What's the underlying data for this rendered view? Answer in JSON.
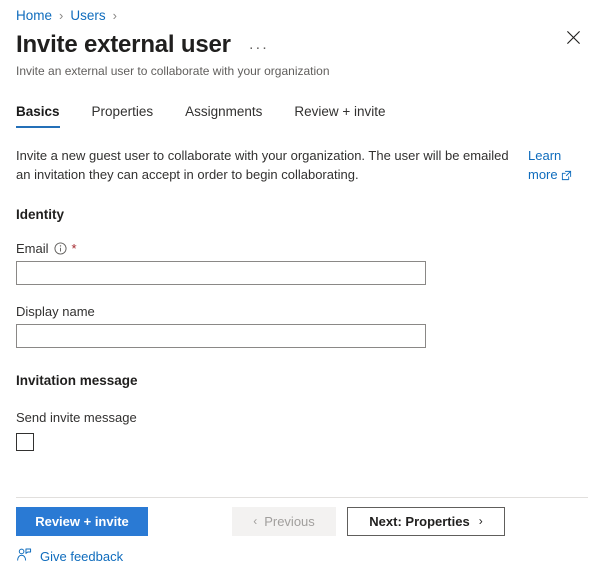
{
  "breadcrumb": {
    "items": [
      {
        "label": "Home"
      },
      {
        "label": "Users"
      }
    ],
    "separator": "›"
  },
  "header": {
    "title": "Invite external user",
    "ellipsis": "···",
    "subtitle": "Invite an external user to collaborate with your organization",
    "close_icon": "close-icon"
  },
  "tabs": [
    {
      "label": "Basics",
      "active": true
    },
    {
      "label": "Properties",
      "active": false
    },
    {
      "label": "Assignments",
      "active": false
    },
    {
      "label": "Review + invite",
      "active": false
    }
  ],
  "intro": {
    "text": "Invite a new guest user to collaborate with your organization. The user will be emailed an invitation they can accept in order to begin collaborating.",
    "learn_more": "Learn more",
    "external_link_icon": "external-link-icon"
  },
  "sections": {
    "identity": {
      "heading": "Identity",
      "email": {
        "label": "Email",
        "info_icon": "info-icon",
        "required_marker": "*",
        "value": "",
        "placeholder": ""
      },
      "display_name": {
        "label": "Display name",
        "value": "",
        "placeholder": ""
      }
    },
    "invitation_message": {
      "heading": "Invitation message",
      "send_invite": {
        "label": "Send invite message",
        "checked": false
      }
    }
  },
  "footer": {
    "review_invite": "Review + invite",
    "previous": "Previous",
    "previous_disabled": true,
    "previous_chevron": "‹",
    "next": "Next: Properties",
    "next_chevron": "›",
    "feedback": "Give feedback",
    "feedback_icon": "person-feedback-icon"
  },
  "colors": {
    "accent": "#0f6cbd",
    "primary_button": "#2a7ad4",
    "tab_underline": "#2470b8",
    "required": "#a4262c",
    "text": "#323130"
  }
}
